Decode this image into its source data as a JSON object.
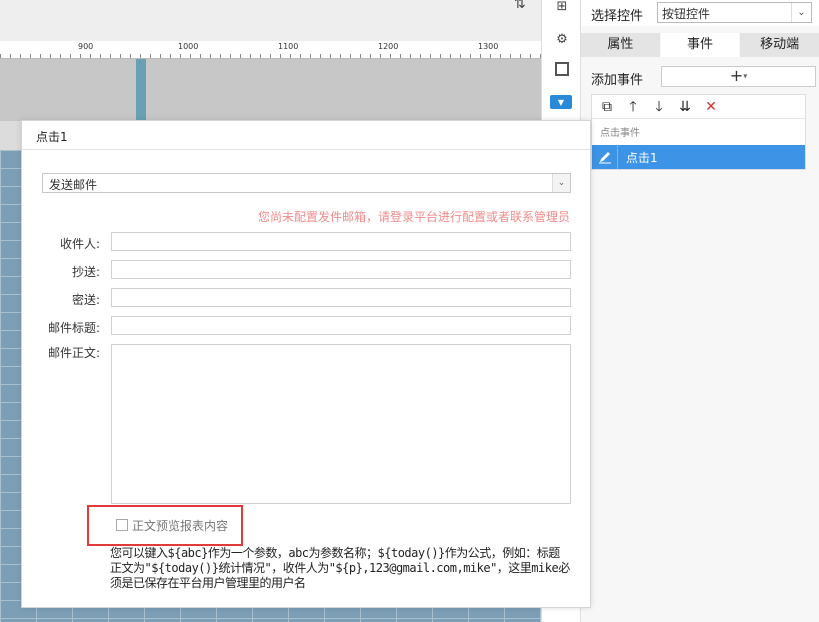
{
  "ruler": {
    "labels": [
      "900",
      "1000",
      "1100",
      "1200",
      "1300"
    ]
  },
  "right_panel": {
    "control_label": "选择控件",
    "control_value": "按钮控件",
    "tabs": [
      {
        "label": "属性"
      },
      {
        "label": "事件"
      },
      {
        "label": "移动端"
      }
    ],
    "add_event_label": "添加事件",
    "add_event_button": "+",
    "event_list_header": "点击事件",
    "event_item": "点击1"
  },
  "dialog": {
    "title": "点击1",
    "action_value": "发送邮件",
    "warning": "您尚未配置发件邮箱，请登录平台进行配置或者联系管理员",
    "fields": {
      "recipient_label": "收件人:",
      "cc_label": "抄送:",
      "bcc_label": "密送:",
      "subject_label": "邮件标题:",
      "body_label": "邮件正文:"
    },
    "preview_label": "正文预览报表内容",
    "hint": "您可以键入${abc}作为一个参数，abc为参数名称；${today()}作为公式，例如：标题正文为\"${today()}统计情况\"，收件人为\"${p},123@gmail.com,mike\"，这里mike必须是已保存在平台用户管理里的用户名"
  },
  "colors": {
    "accent": "#3d93e6",
    "warning": "#f08b8b",
    "highlight_border": "#e23a3a"
  }
}
